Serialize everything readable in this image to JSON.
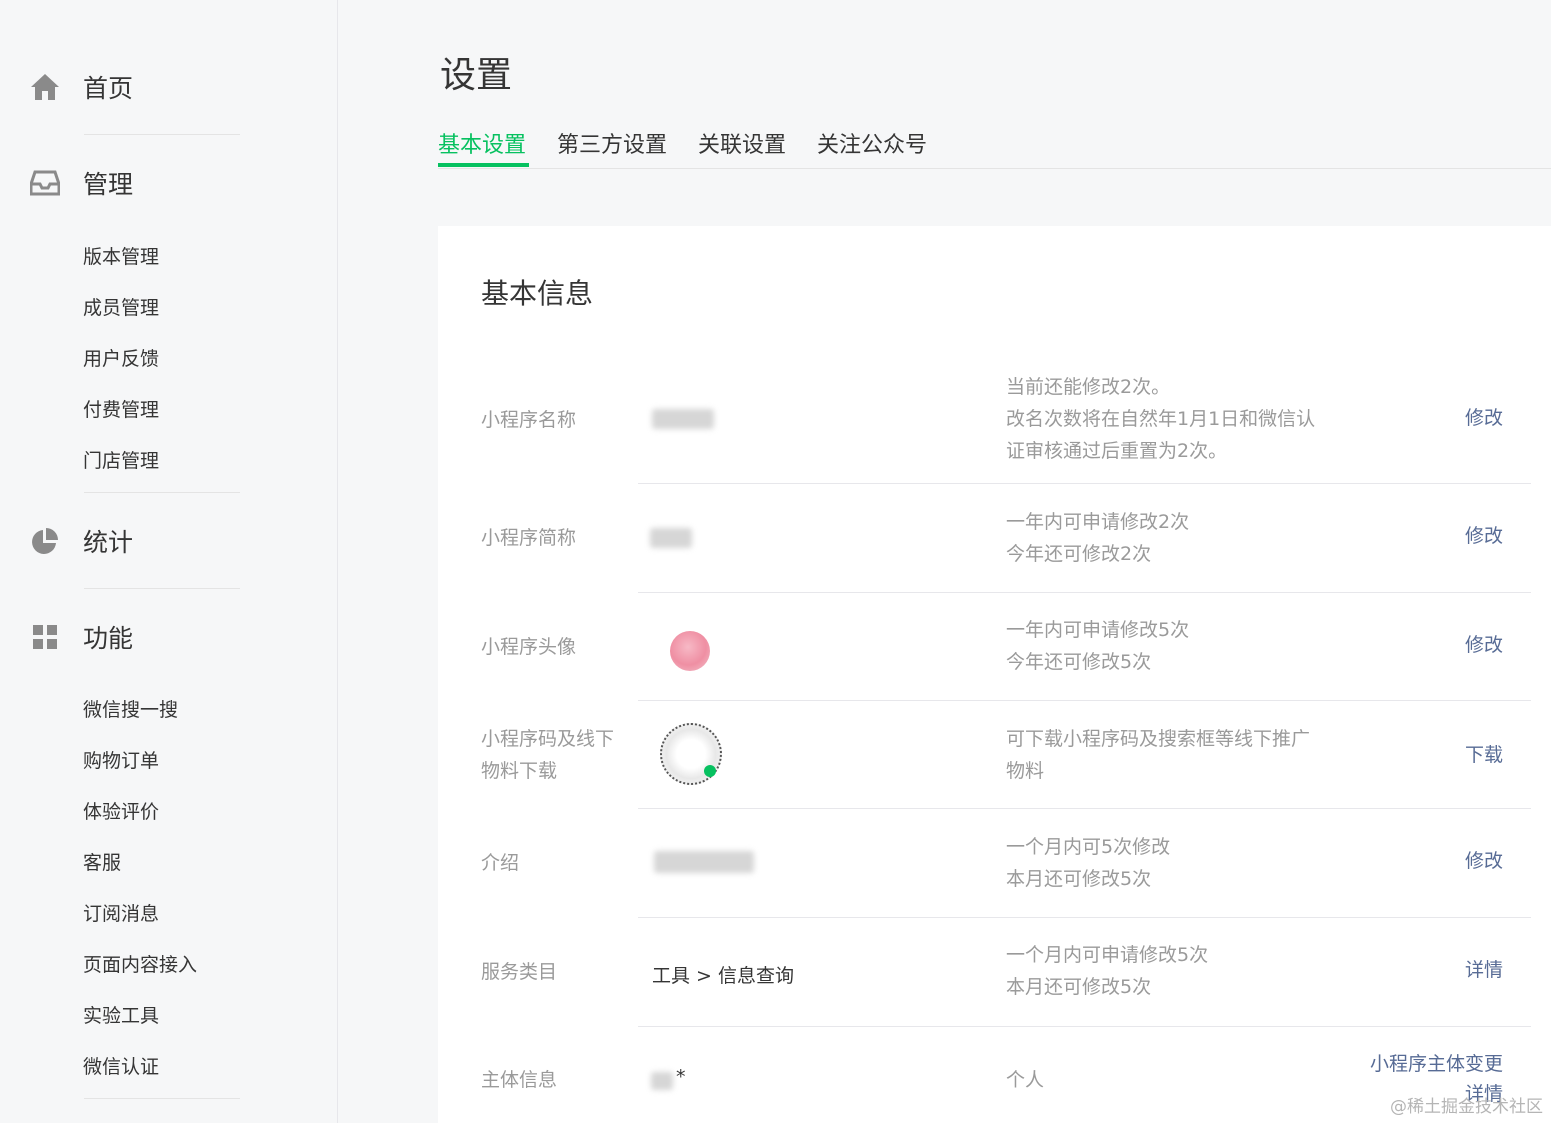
{
  "sidebar": {
    "sections": [
      {
        "label": "首页",
        "icon": "home-icon"
      },
      {
        "label": "管理",
        "icon": "inbox-icon",
        "items": [
          "版本管理",
          "成员管理",
          "用户反馈",
          "付费管理",
          "门店管理"
        ]
      },
      {
        "label": "统计",
        "icon": "pie-chart-icon"
      },
      {
        "label": "功能",
        "icon": "grid-icon",
        "items": [
          "微信搜一搜",
          "购物订单",
          "体验评价",
          "客服",
          "订阅消息",
          "页面内容接入",
          "实验工具",
          "微信认证"
        ]
      }
    ]
  },
  "page": {
    "title": "设置",
    "tabs": [
      "基本设置",
      "第三方设置",
      "关联设置",
      "关注公众号"
    ],
    "active_tab": 0
  },
  "card": {
    "title": "基本信息",
    "rows": [
      {
        "label": "小程序名称",
        "desc": [
          "当前还能修改2次。",
          "改名次数将在自然年1月1日和微信认",
          "证审核通过后重置为2次。"
        ],
        "action": "修改"
      },
      {
        "label": "小程序简称",
        "desc": [
          "一年内可申请修改2次",
          "今年还可修改2次"
        ],
        "action": "修改"
      },
      {
        "label": "小程序头像",
        "desc": [
          "一年内可申请修改5次",
          "今年还可修改5次"
        ],
        "action": "修改"
      },
      {
        "label": "小程序码及线下物料下载",
        "desc": [
          "可下载小程序码及搜索框等线下推广",
          "物料"
        ],
        "action": "下载"
      },
      {
        "label": "介绍",
        "desc": [
          "一个月内可5次修改",
          "本月还可修改5次"
        ],
        "action": "修改"
      },
      {
        "label": "服务类目",
        "value": "工具 > 信息查询",
        "desc": [
          "一个月内可申请修改5次",
          "本月还可修改5次"
        ],
        "action": "详情"
      },
      {
        "label": "主体信息",
        "value": "*",
        "desc": [
          "个人"
        ],
        "action": "小程序主体变更",
        "action2": "详情"
      }
    ]
  },
  "watermark": "@稀土掘金技术社区",
  "colors": {
    "accent": "#07c160",
    "link": "#576b95",
    "muted": "#9a9a9a"
  }
}
